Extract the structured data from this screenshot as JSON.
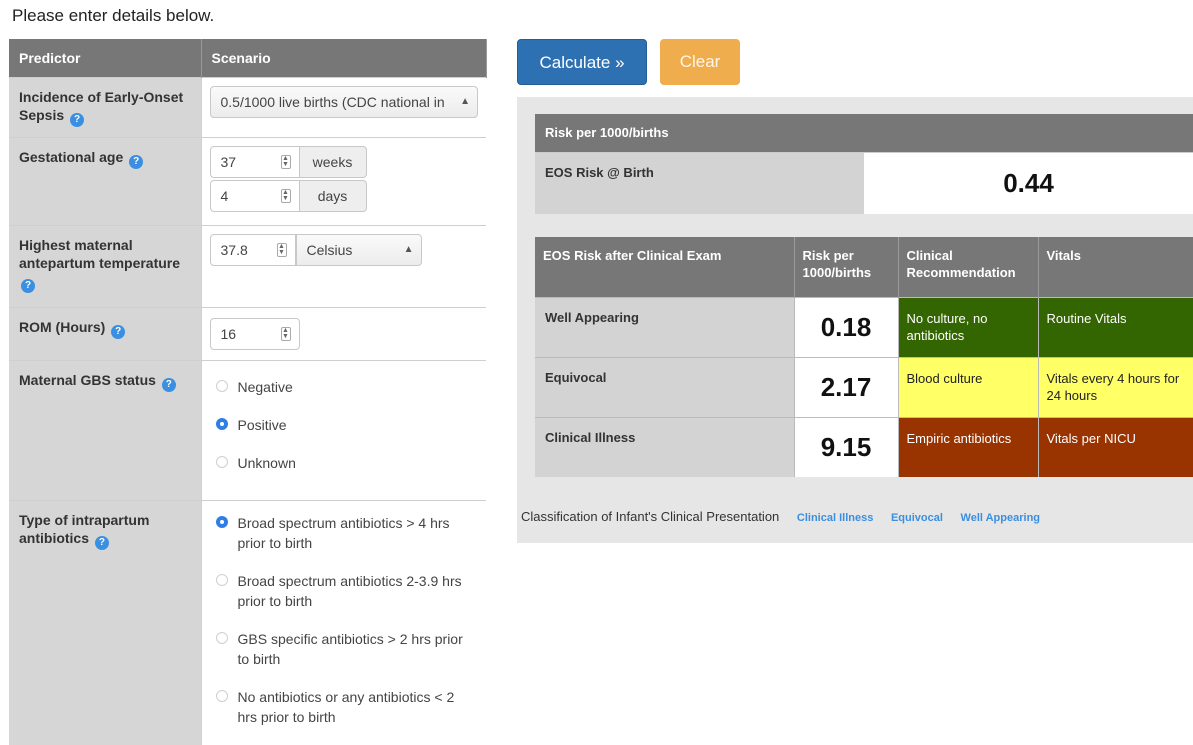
{
  "page_title": "Please enter details below.",
  "form": {
    "headers": [
      "Predictor",
      "Scenario"
    ],
    "incidence": {
      "label": "Incidence of Early-Onset Sepsis",
      "value": "0.5/1000 live births (CDC national in"
    },
    "gestational_age": {
      "label": "Gestational age",
      "weeks_value": "37",
      "weeks_unit": "weeks",
      "days_value": "4",
      "days_unit": "days"
    },
    "temperature": {
      "label": "Highest maternal antepartum temperature",
      "value": "37.8",
      "unit": "Celsius"
    },
    "rom": {
      "label": "ROM (Hours)",
      "value": "16"
    },
    "gbs": {
      "label": "Maternal GBS status",
      "options": [
        "Negative",
        "Positive",
        "Unknown"
      ],
      "selected": "Positive"
    },
    "antibiotics": {
      "label": "Type of intrapartum antibiotics",
      "options": [
        "Broad spectrum antibiotics > 4 hrs prior to birth",
        "Broad spectrum antibiotics 2-3.9 hrs prior to birth",
        "GBS specific antibiotics > 2 hrs prior to birth",
        "No antibiotics or any antibiotics < 2 hrs prior to birth"
      ],
      "selected": "Broad spectrum antibiotics > 4 hrs prior to birth"
    }
  },
  "buttons": {
    "calculate": "Calculate »",
    "clear": "Clear"
  },
  "results": {
    "risk_header": "Risk per 1000/births",
    "birth_label": "EOS Risk @ Birth",
    "birth_value": "0.44",
    "exam_headers": [
      "EOS Risk after Clinical Exam",
      "Risk per 1000/births",
      "Clinical Recommendation",
      "Vitals"
    ],
    "rows": [
      {
        "label": "Well Appearing",
        "risk": "0.18",
        "recommendation": "No culture, no antibiotics",
        "vitals": "Routine Vitals"
      },
      {
        "label": "Equivocal",
        "risk": "2.17",
        "recommendation": "Blood culture",
        "vitals": "Vitals every 4 hours for 24 hours"
      },
      {
        "label": "Clinical Illness",
        "risk": "9.15",
        "recommendation": "Empiric antibiotics",
        "vitals": "Vitals per NICU"
      }
    ],
    "classification_label": "Classification of Infant's Clinical Presentation",
    "classification_links": [
      "Clinical Illness",
      "Equivocal",
      "Well Appearing"
    ]
  },
  "colors": {
    "green": "#336600",
    "yellow": "#ffff66",
    "red": "#993300",
    "primary": "#2e71b3",
    "warning": "#f0ad4e"
  }
}
